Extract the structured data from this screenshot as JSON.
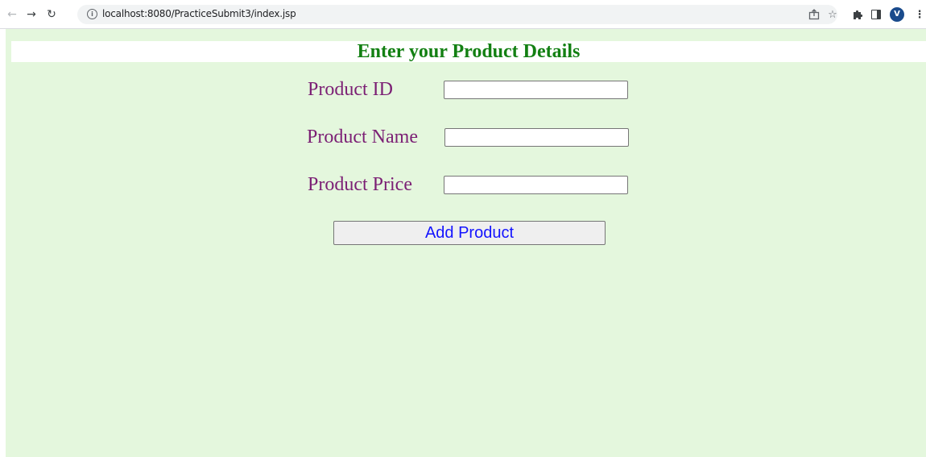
{
  "browser": {
    "url": "localhost:8080/PracticeSubmit3/index.jsp",
    "profile_initial": "V",
    "icons": [
      "back-arrow-icon",
      "forward-arrow-icon",
      "reload-icon",
      "info-icon",
      "share-icon",
      "star-icon",
      "extensions-icon",
      "side-panel-icon",
      "menu-icon"
    ]
  },
  "form": {
    "heading": "Enter your Product Details",
    "fields": [
      {
        "label": "Product ID",
        "value": ""
      },
      {
        "label": "Product Name",
        "value": ""
      },
      {
        "label": "Product Price",
        "value": ""
      }
    ],
    "submit_label": "Add Product"
  },
  "colors": {
    "page_background": "#e4f7dd",
    "heading": "#138013",
    "label": "#7b1f74",
    "button_text": "#1414ff"
  }
}
